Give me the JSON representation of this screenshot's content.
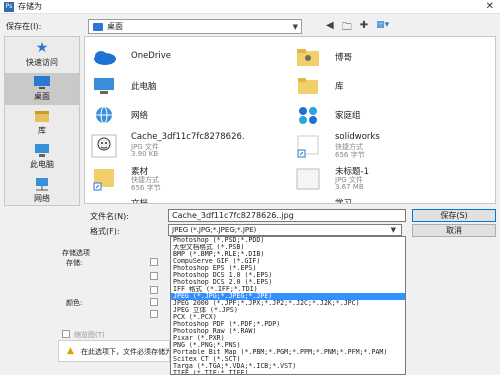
{
  "window": {
    "title": "存储为",
    "app_icon": "Ps"
  },
  "save_in": {
    "label": "保存在(I):",
    "location": "桌面"
  },
  "places": [
    {
      "label": "快速访问",
      "icon": "star-icon"
    },
    {
      "label": "桌面",
      "icon": "desktop-icon",
      "selected": true
    },
    {
      "label": "库",
      "icon": "library-icon"
    },
    {
      "label": "此电脑",
      "icon": "computer-icon"
    },
    {
      "label": "网络",
      "icon": "network-icon"
    }
  ],
  "files": [
    {
      "name": "OneDrive",
      "meta1": "",
      "meta2": ""
    },
    {
      "name": "博哥",
      "meta1": "",
      "meta2": ""
    },
    {
      "name": "此电脑",
      "meta1": "",
      "meta2": ""
    },
    {
      "name": "库",
      "meta1": "",
      "meta2": ""
    },
    {
      "name": "网络",
      "meta1": "",
      "meta2": ""
    },
    {
      "name": "家庭组",
      "meta1": "",
      "meta2": ""
    },
    {
      "name": "Cache_3df11c7fc8278626.",
      "meta1": "JPG 文件",
      "meta2": "3.90 KB"
    },
    {
      "name": "solidworks",
      "meta1": "快捷方式",
      "meta2": "656 字节"
    },
    {
      "name": "素材",
      "meta1": "快捷方式",
      "meta2": "656 字节"
    },
    {
      "name": "未标题-1",
      "meta1": "JPG 文件",
      "meta2": "3.67 MB"
    },
    {
      "name": "文档",
      "meta1": "",
      "meta2": ""
    },
    {
      "name": "学习",
      "meta1": "",
      "meta2": ""
    }
  ],
  "filename": {
    "label": "文件名(N):",
    "value": "Cache_3df11c7fc8278626..jpg"
  },
  "format": {
    "label": "格式(F):",
    "value": "JPEG (*.JPG;*.JPEG;*.JPE)"
  },
  "buttons": {
    "save": "保存(S)",
    "cancel": "取消"
  },
  "save_options": {
    "title": "存储选项",
    "store_label": "存储:",
    "color_label": "颜色:",
    "thumbnail_label": "缩览图(T)",
    "warning_text": "在此选项下，文件必须存储为副本。"
  },
  "format_options": [
    "Photoshop (*.PSD;*.PDD)",
    "大型文档格式 (*.PSB)",
    "BMP (*.BMP;*.RLE;*.DIB)",
    "CompuServe GIF (*.GIF)",
    "Photoshop EPS (*.EPS)",
    "Photoshop DCS 1.0 (*.EPS)",
    "Photoshop DCS 2.0 (*.EPS)",
    "IFF 格式 (*.IFF;*.TDI)",
    "JPEG (*.JPG;*.JPEG;*.JPE)",
    "JPEG 2000 (*.JPF;*.JPX;*.JP2;*.J2C;*.J2K;*.JPC)",
    "JPEG 立体 (*.JPS)",
    "PCX (*.PCX)",
    "Photoshop PDF (*.PDF;*.PDP)",
    "Photoshop Raw (*.RAW)",
    "Pixar (*.PXR)",
    "PNG (*.PNG;*.PNS)",
    "Portable Bit Map (*.PBM;*.PGM;*.PPM;*.PNM;*.PFM;*.PAM)",
    "Scitex CT (*.SCT)",
    "Targa (*.TGA;*.VDA;*.ICB;*.VST)",
    "TIFF (*.TIF;*.TIFF)"
  ],
  "format_selected_index": 8,
  "colors": {
    "accent": "#0078d7",
    "highlight": "#3390ff",
    "folder": "#2a78d2",
    "warning": "#d9a200"
  }
}
